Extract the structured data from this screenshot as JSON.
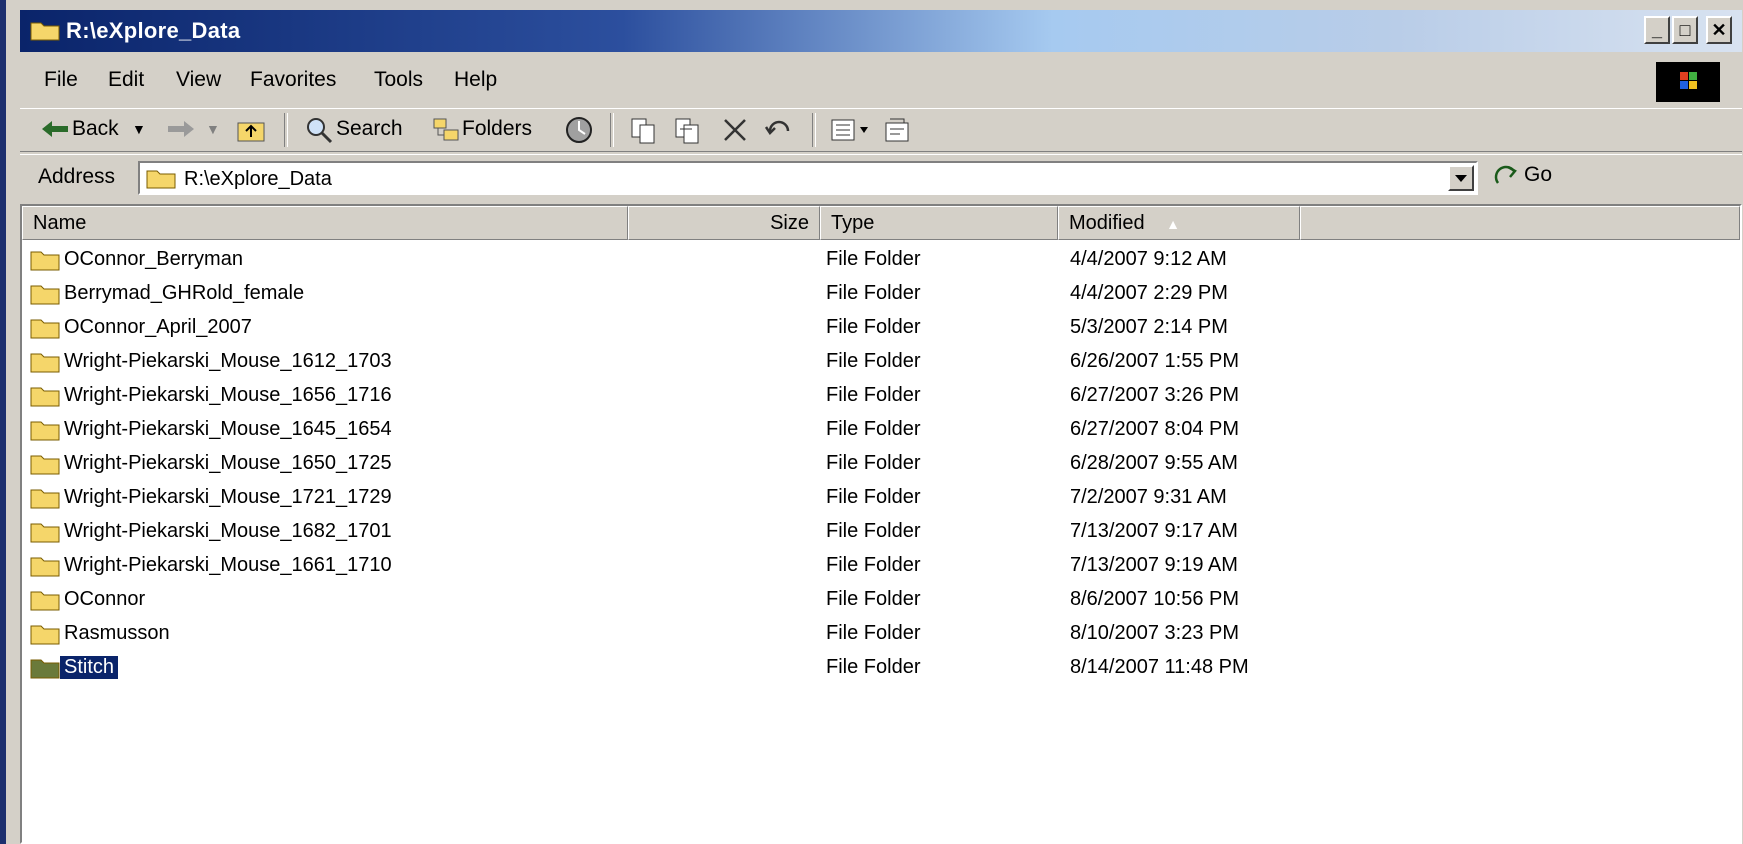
{
  "window": {
    "title": "R:\\eXplore_Data",
    "minimize": "_",
    "maximize": "□",
    "close": "✕"
  },
  "menubar": [
    "File",
    "Edit",
    "View",
    "Favorites",
    "Tools",
    "Help"
  ],
  "toolbar": {
    "back": "Back",
    "search": "Search",
    "folders": "Folders"
  },
  "address": {
    "label": "Address",
    "value": "R:\\eXplore_Data",
    "go": "Go"
  },
  "columns": {
    "name": "Name",
    "size": "Size",
    "type": "Type",
    "modified": "Modified"
  },
  "files": [
    {
      "name": "OConnor_Berryman",
      "type": "File Folder",
      "modified": "4/4/2007 9:12 AM"
    },
    {
      "name": "Berrymad_GHRold_female",
      "type": "File Folder",
      "modified": "4/4/2007 2:29 PM"
    },
    {
      "name": "OConnor_April_2007",
      "type": "File Folder",
      "modified": "5/3/2007 2:14 PM"
    },
    {
      "name": "Wright-Piekarski_Mouse_1612_1703",
      "type": "File Folder",
      "modified": "6/26/2007 1:55 PM"
    },
    {
      "name": "Wright-Piekarski_Mouse_1656_1716",
      "type": "File Folder",
      "modified": "6/27/2007 3:26 PM"
    },
    {
      "name": "Wright-Piekarski_Mouse_1645_1654",
      "type": "File Folder",
      "modified": "6/27/2007 8:04 PM"
    },
    {
      "name": "Wright-Piekarski_Mouse_1650_1725",
      "type": "File Folder",
      "modified": "6/28/2007 9:55 AM"
    },
    {
      "name": "Wright-Piekarski_Mouse_1721_1729",
      "type": "File Folder",
      "modified": "7/2/2007 9:31 AM"
    },
    {
      "name": "Wright-Piekarski_Mouse_1682_1701",
      "type": "File Folder",
      "modified": "7/13/2007 9:17 AM"
    },
    {
      "name": "Wright-Piekarski_Mouse_1661_1710",
      "type": "File Folder",
      "modified": "7/13/2007 9:19 AM"
    },
    {
      "name": "OConnor",
      "type": "File Folder",
      "modified": "8/6/2007 10:56 PM"
    },
    {
      "name": "Rasmusson",
      "type": "File Folder",
      "modified": "8/10/2007 3:23 PM"
    },
    {
      "name": "Stitch",
      "type": "File Folder",
      "modified": "8/14/2007 11:48 PM",
      "selected": true
    }
  ],
  "colors": {
    "titlebar": "#0a246a",
    "selection": "#0a246a",
    "chrome": "#d4d0c8",
    "folder": "#f5d66a"
  }
}
